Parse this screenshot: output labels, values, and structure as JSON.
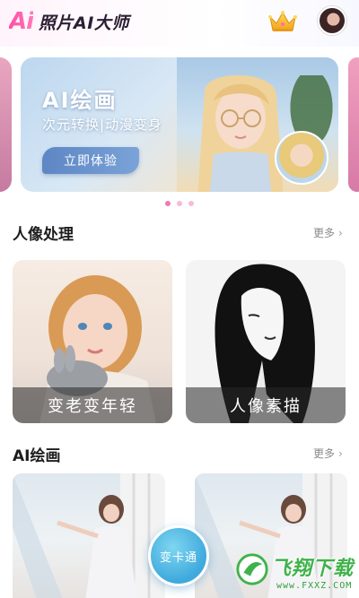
{
  "header": {
    "logo_mark": "Ai",
    "app_name": "照片AI大师"
  },
  "banner": {
    "title": "AI绘画",
    "subtitle": "次元转换|动漫变身",
    "button_label": "立即体验"
  },
  "carousel": {
    "count": 3,
    "active_index": 0
  },
  "section_portrait": {
    "title": "人像处理",
    "more_label": "更多",
    "cards": [
      {
        "label": "变老变年轻"
      },
      {
        "label": "人像素描"
      }
    ]
  },
  "section_ai": {
    "title": "AI绘画",
    "more_label": "更多"
  },
  "fab": {
    "label": "变卡通"
  },
  "watermark": {
    "brand": "飞翔下载",
    "url": "www.FXXZ.COM"
  },
  "colors": {
    "brand_pink": "#ff4fa3",
    "banner_button": "#5d86c4",
    "fab_blue": "#3ea9dd",
    "dot_active": "#f07ab0",
    "dot_inactive": "#f6bcd6"
  },
  "icons": {
    "crown": "crown-icon",
    "more": "chevron-right-icon"
  }
}
